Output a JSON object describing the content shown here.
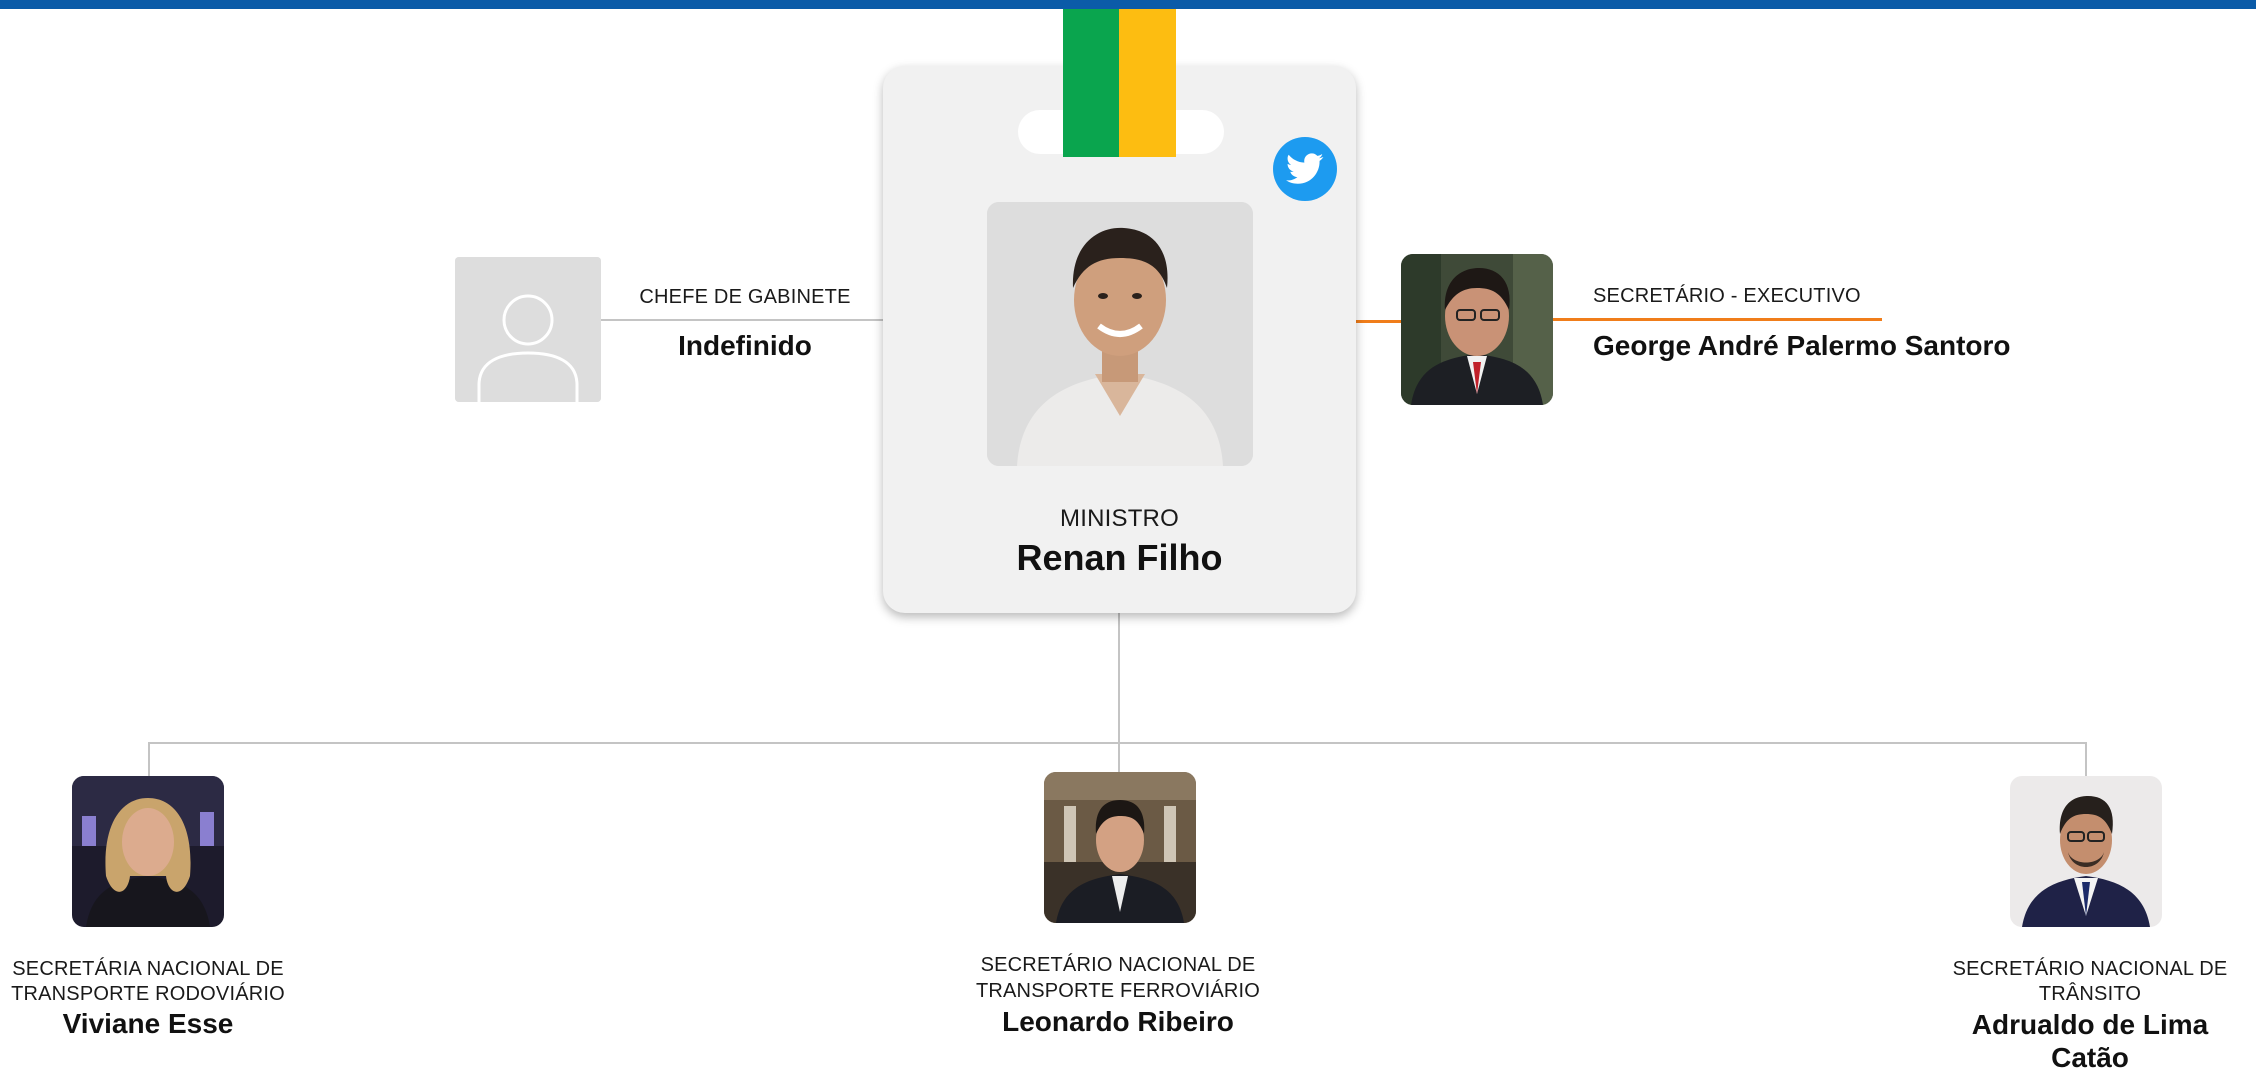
{
  "minister": {
    "role": "MINISTRO",
    "name": "Renan Filho"
  },
  "chief_of_staff": {
    "role": "CHEFE DE GABINETE",
    "name": "Indefinido"
  },
  "executive_secretary": {
    "role": "SECRETÁRIO - EXECUTIVO",
    "name": "George André Palermo Santoro"
  },
  "secretaries": [
    {
      "role_line1": "SECRETÁRIA NACIONAL DE",
      "role_line2": "TRANSPORTE RODOVIÁRIO",
      "name_line1": "Viviane Esse",
      "name_line2": ""
    },
    {
      "role_line1": "SECRETÁRIO NACIONAL DE",
      "role_line2": "TRANSPORTE FERROVIÁRIO",
      "name_line1": "Leonardo Ribeiro",
      "name_line2": ""
    },
    {
      "role_line1": "SECRETÁRIO NACIONAL DE",
      "role_line2": "TRÂNSITO",
      "name_line1": "Adrualdo de Lima",
      "name_line2": "Catão"
    }
  ],
  "icons": {
    "social": "twitter-icon",
    "placeholder": "user-placeholder-icon"
  },
  "colors": {
    "top_bar": "#0b5ba8",
    "ribbon_green": "#0aa54e",
    "ribbon_yellow": "#fdbd11",
    "twitter": "#1d9bf0",
    "connector": "#c4c4c4",
    "executive_connector": "#f07d1a"
  }
}
